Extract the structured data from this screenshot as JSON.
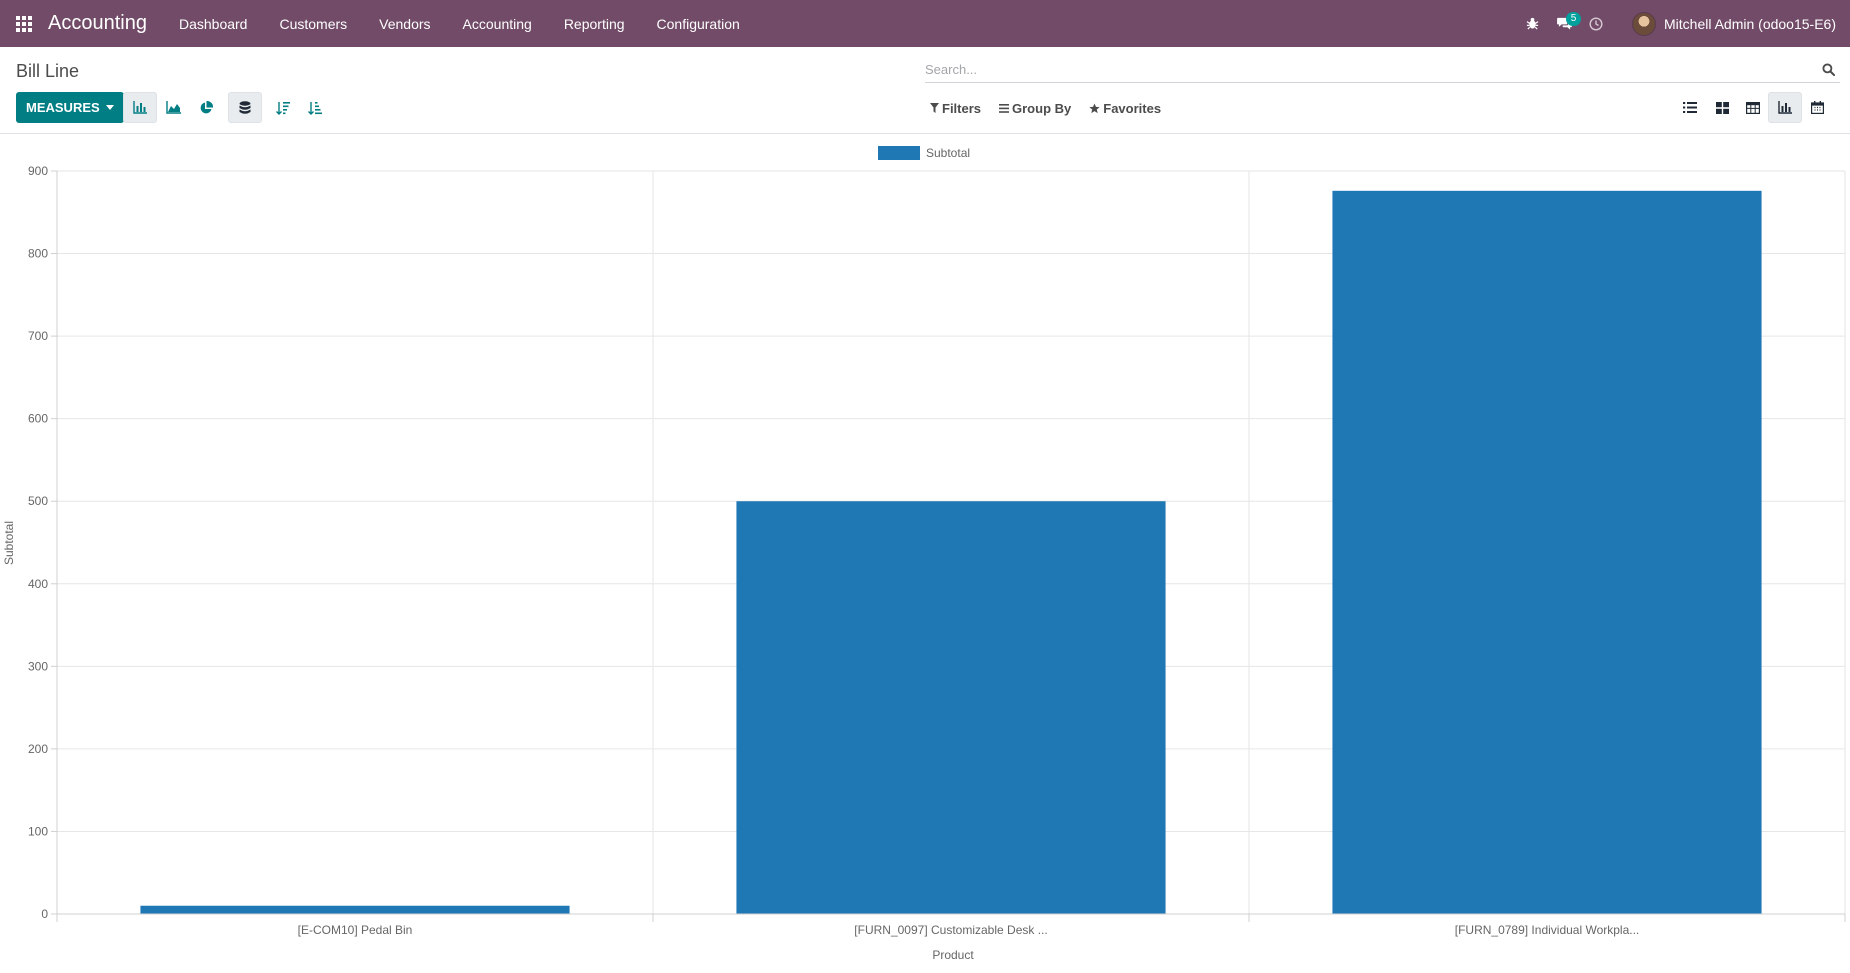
{
  "navbar": {
    "app_name": "Accounting",
    "menu": [
      "Dashboard",
      "Customers",
      "Vendors",
      "Accounting",
      "Reporting",
      "Configuration"
    ],
    "messages_count": "5",
    "user_name": "Mitchell Admin (odoo15-E6)"
  },
  "control_panel": {
    "breadcrumb": "Bill Line",
    "search_placeholder": "Search...",
    "measures_label": "MEASURES",
    "filters_label": "Filters",
    "group_by_label": "Group By",
    "favorites_label": "Favorites"
  },
  "colors": {
    "navbar": "#714b67",
    "primary_button": "#017e84",
    "bar": "#1f77b4",
    "badge": "#00a09d"
  },
  "chart_data": {
    "type": "bar",
    "categories": [
      "[E-COM10] Pedal Bin",
      "[FURN_0097] Customizable Desk ...",
      "[FURN_0789] Individual Workpla..."
    ],
    "series": [
      {
        "name": "Subtotal",
        "values": [
          10,
          500,
          876
        ],
        "color": "#1f77b4"
      }
    ],
    "xlabel": "Product",
    "ylabel": "Subtotal",
    "ylim": [
      0,
      900
    ],
    "yticks": [
      0,
      100,
      200,
      300,
      400,
      500,
      600,
      700,
      800,
      900
    ],
    "grid": true,
    "legend": "top-center"
  }
}
